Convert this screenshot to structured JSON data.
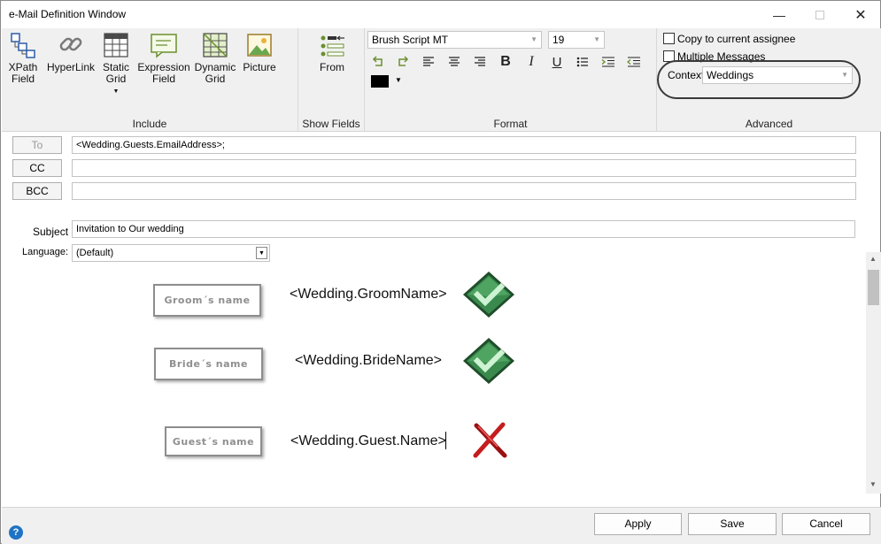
{
  "window": {
    "title": "e-Mail Definition Window"
  },
  "ribbon": {
    "include": {
      "label": "Include",
      "buttons": [
        {
          "label": "XPath\nField",
          "line1": "XPath",
          "line2": "Field",
          "icon": "xpath-field-icon"
        },
        {
          "label": "HyperLink",
          "icon": "hyperlink-icon"
        },
        {
          "line1": "Static",
          "line2": "Grid",
          "icon": "static-grid-icon"
        },
        {
          "line1": "Expression",
          "line2": "Field",
          "icon": "expression-field-icon"
        },
        {
          "line1": "Dynamic",
          "line2": "Grid",
          "icon": "dynamic-grid-icon"
        },
        {
          "label": "Picture",
          "icon": "picture-icon"
        }
      ]
    },
    "show_fields": {
      "label": "Show Fields",
      "from_label": "From"
    },
    "format": {
      "label": "Format",
      "font": "Brush Script MT",
      "size": "19",
      "color": "#000000"
    },
    "advanced": {
      "label": "Advanced",
      "copy_assignee": "Copy to current assignee",
      "multiple_messages": "Multiple Messages",
      "context_label": "Context",
      "context_value": "Weddings"
    }
  },
  "form": {
    "to_label": "To",
    "to_value": "<Wedding.Guests.EmailAddress>;",
    "cc_label": "CC",
    "cc_value": "",
    "bcc_label": "BCC",
    "bcc_value": "",
    "subject_label": "Subject",
    "subject_value": "Invitation to Our wedding",
    "language_label": "Language:",
    "language_value": "(Default)"
  },
  "body": {
    "rows": [
      {
        "label": "Groom´s name",
        "field": "<Wedding.GroomName>",
        "status": "check"
      },
      {
        "label": "Bride´s name",
        "field": "<Wedding.BrideName>",
        "status": "check"
      },
      {
        "label": "Guest´s name",
        "field": "<Wedding.Guest.Name>",
        "status": "cross"
      }
    ]
  },
  "footer": {
    "apply": "Apply",
    "save": "Save",
    "cancel": "Cancel"
  }
}
